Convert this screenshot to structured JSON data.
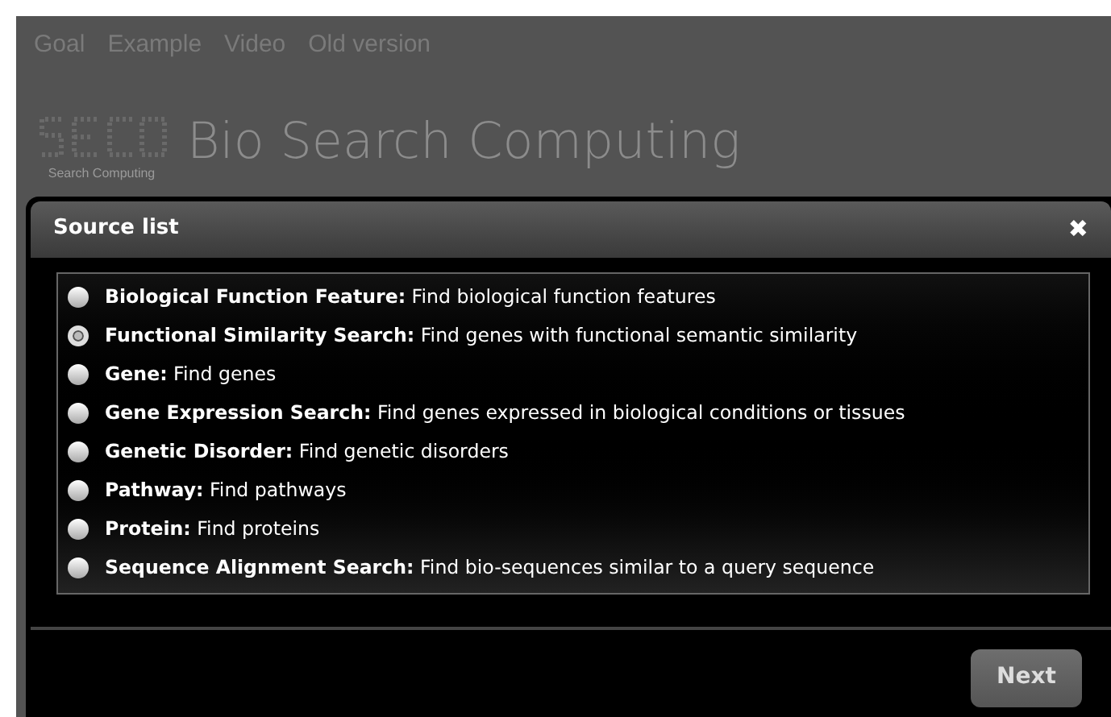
{
  "nav": [
    "Goal",
    "Example",
    "Video",
    "Old version"
  ],
  "logo": {
    "caption": "Search Computing"
  },
  "site_title": "Bio Search Computing",
  "dialog": {
    "title": "Source list",
    "close": "✖",
    "sources": [
      {
        "text": "**Biological Function Feature:** Find biological function features",
        "selected": false
      },
      {
        "text": "**Functional Similarity Search:** Find genes with functional semantic similarity",
        "selected": true
      },
      {
        "text": "**Gene:** Find genes",
        "selected": false
      },
      {
        "text": "**Gene Expression Search:** Find genes expressed in biological conditions or tissues",
        "selected": false
      },
      {
        "text": "**Genetic Disorder:** Find genetic disorders",
        "selected": false
      },
      {
        "text": "**Pathway:** Find pathways",
        "selected": false
      },
      {
        "text": "**Protein:** Find proteins",
        "selected": false
      },
      {
        "text": "**Sequence Alignment Search:** Find bio-sequences similar to a query sequence",
        "selected": false
      }
    ],
    "button": "Next"
  }
}
